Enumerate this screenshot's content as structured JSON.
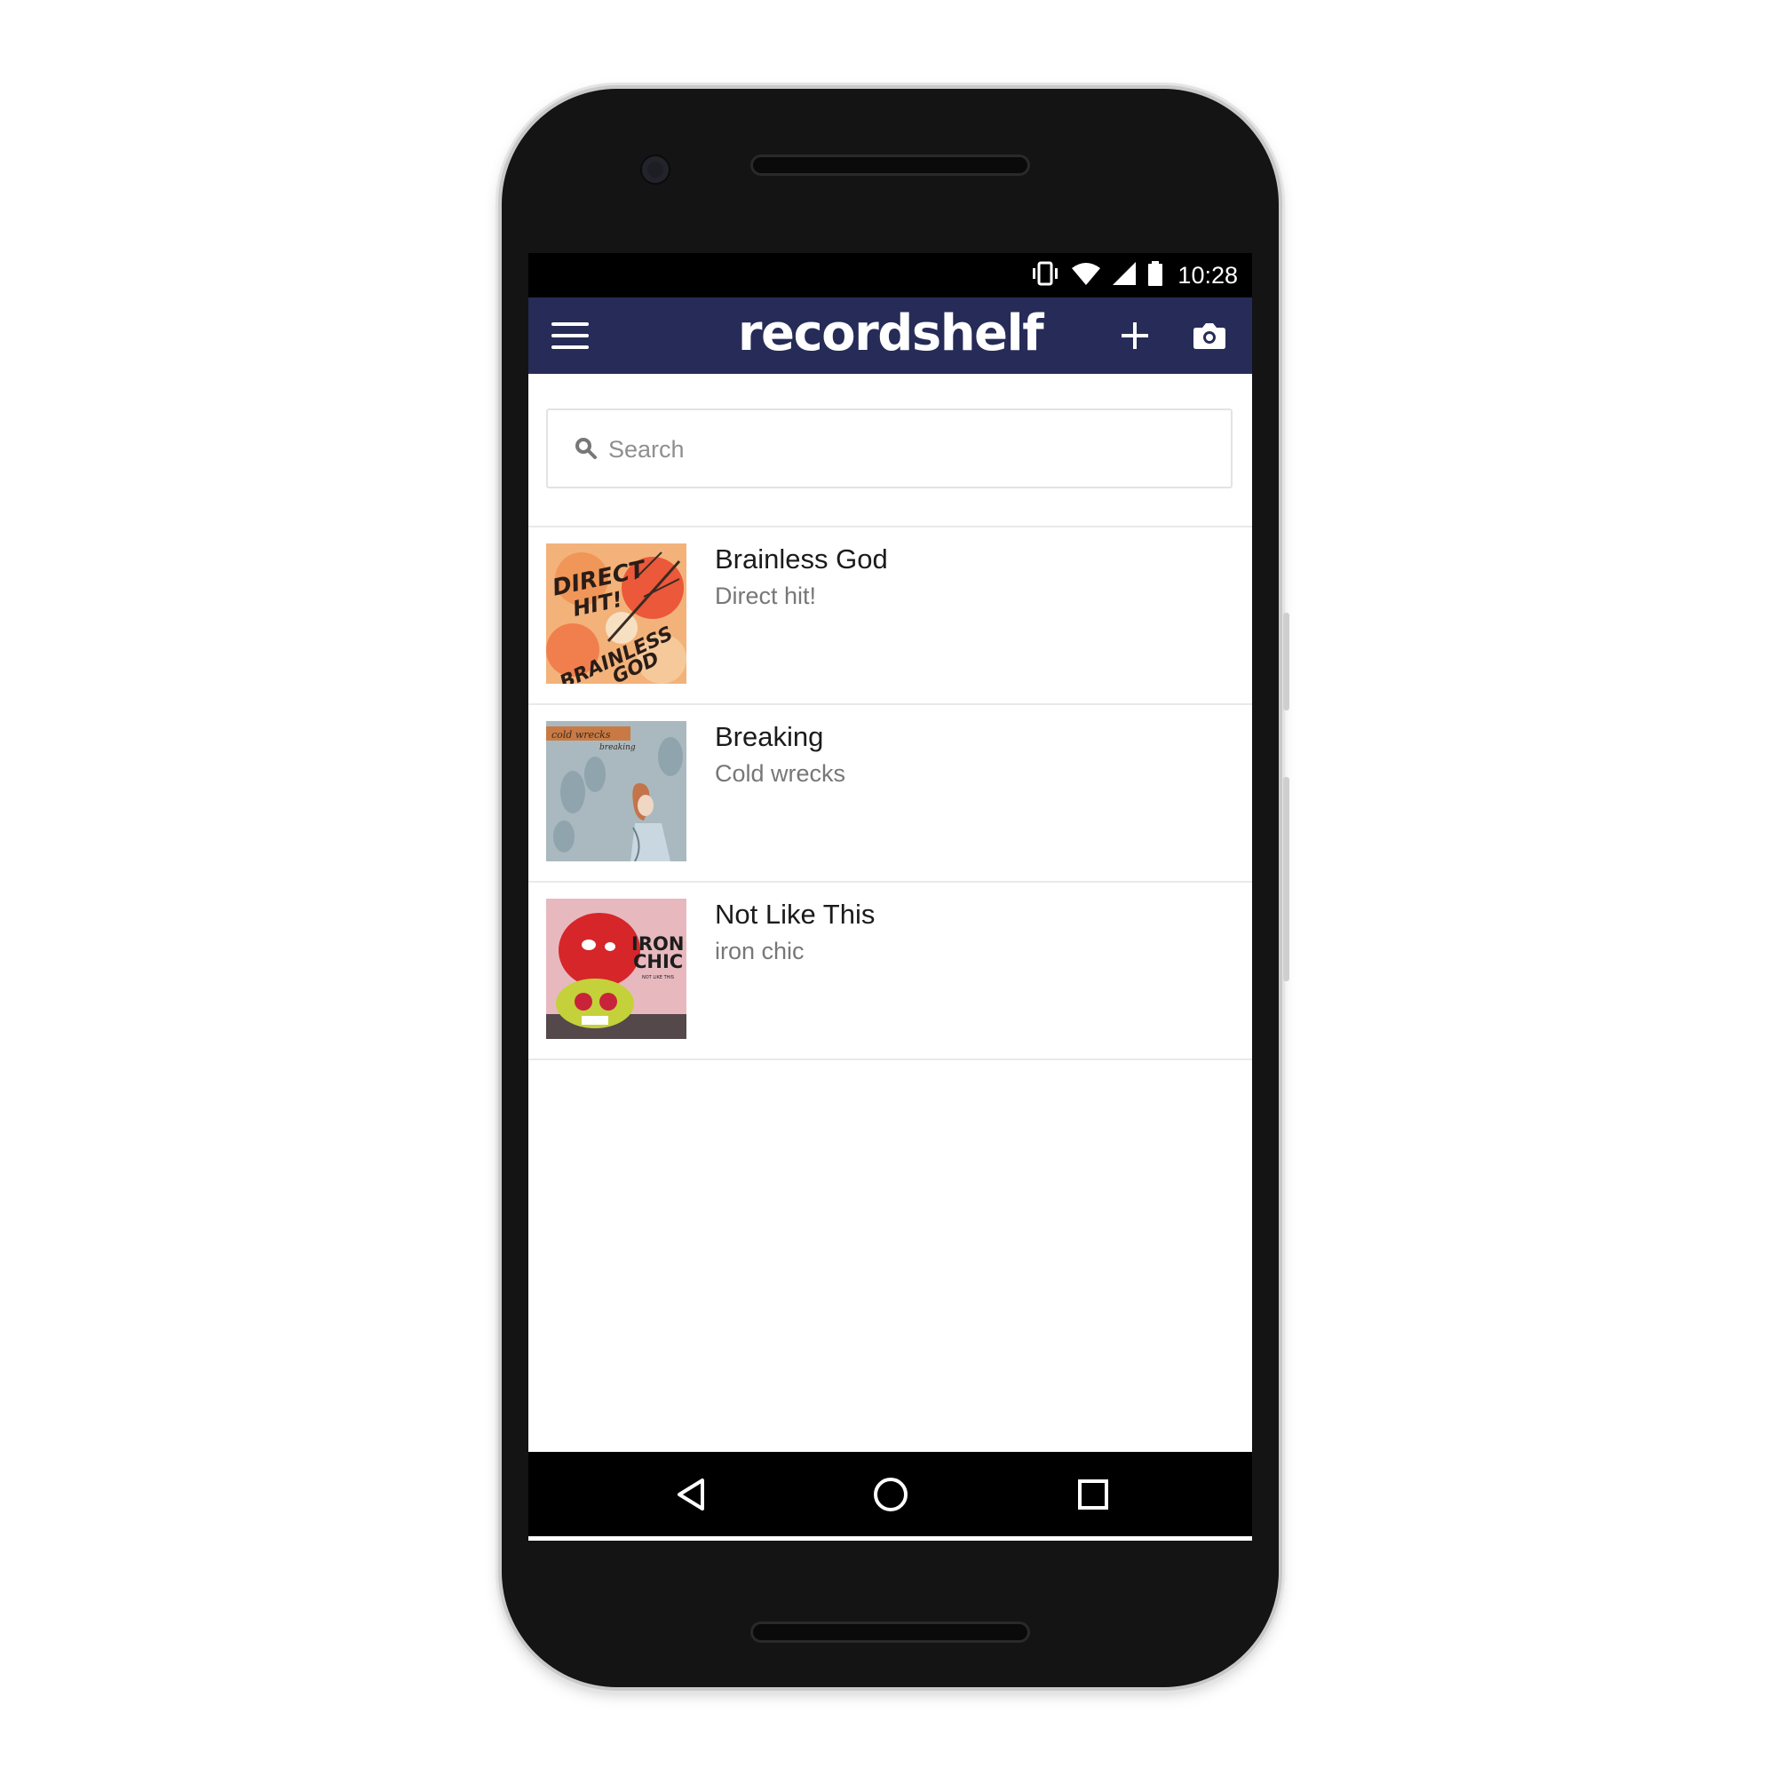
{
  "status_bar": {
    "time": "10:28",
    "icons": [
      "vibrate-icon",
      "wifi-icon",
      "signal-icon",
      "battery-icon"
    ]
  },
  "app_bar": {
    "title": "recordshelf",
    "menu_icon": "hamburger-menu-icon",
    "add_icon": "plus-icon",
    "camera_icon": "camera-icon",
    "background_color": "#262c57"
  },
  "search": {
    "placeholder": "Search",
    "value": "",
    "icon": "search-icon"
  },
  "records": [
    {
      "title": "Brainless God",
      "artist": "Direct hit!",
      "cover_text": [
        "DIRECT",
        "HIT!",
        "BRAINLESS",
        "GOD"
      ]
    },
    {
      "title": "Breaking",
      "artist": "Cold wrecks",
      "cover_text": [
        "cold wrecks",
        "breaking"
      ]
    },
    {
      "title": "Not Like This",
      "artist": "iron chic",
      "cover_text": [
        "IRON",
        "CHIC",
        "NOT LIKE THIS"
      ]
    }
  ],
  "nav_bar": {
    "back_icon": "back-triangle-icon",
    "home_icon": "home-circle-icon",
    "recents_icon": "recents-square-icon"
  }
}
